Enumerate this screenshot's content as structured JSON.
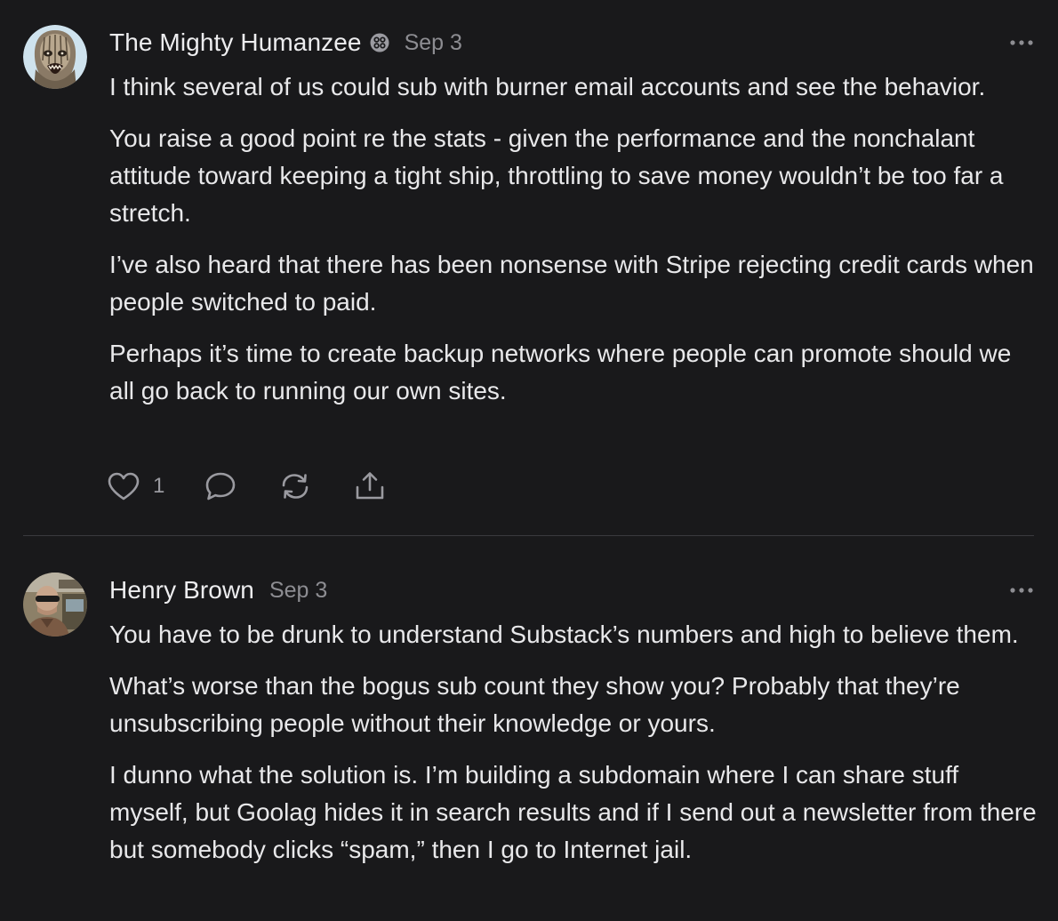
{
  "posts": [
    {
      "author": "The Mighty Humanzee",
      "date": "Sep 3",
      "has_badge": true,
      "paragraphs": [
        "I think several of us could sub with burner email accounts and see the behavior.",
        "You raise a good point re the stats - given the performance and the nonchalant attitude toward keeping a tight ship, throttling to save money wouldn’t be too far a stretch.",
        "I’ve also heard that there has been nonsense with Stripe rejecting credit cards when people switched to paid.",
        "Perhaps it’s time to create backup networks where people can promote should we all go back to running our own sites."
      ],
      "like_count": "1",
      "icons": [
        "heart-icon",
        "comment-icon",
        "restack-icon",
        "share-icon",
        "more-icon"
      ]
    },
    {
      "author": "Henry Brown",
      "date": "Sep 3",
      "has_badge": false,
      "paragraphs": [
        "You have to be drunk to understand Substack’s numbers and high to believe them.",
        "What’s worse than the bogus sub count they show you? Probably that they’re unsubscribing people without their knowledge or yours.",
        "I dunno what the solution is. I’m building a subdomain where I can share stuff myself, but Goolag hides it in search results and if I send out a newsletter from there but somebody clicks “spam,” then I go to Internet jail."
      ],
      "icons": [
        "more-icon"
      ]
    }
  ],
  "colors": {
    "background": "#19191b",
    "text": "#e8e8ea",
    "muted": "#8d8d92",
    "divider": "#3a3a3e"
  }
}
